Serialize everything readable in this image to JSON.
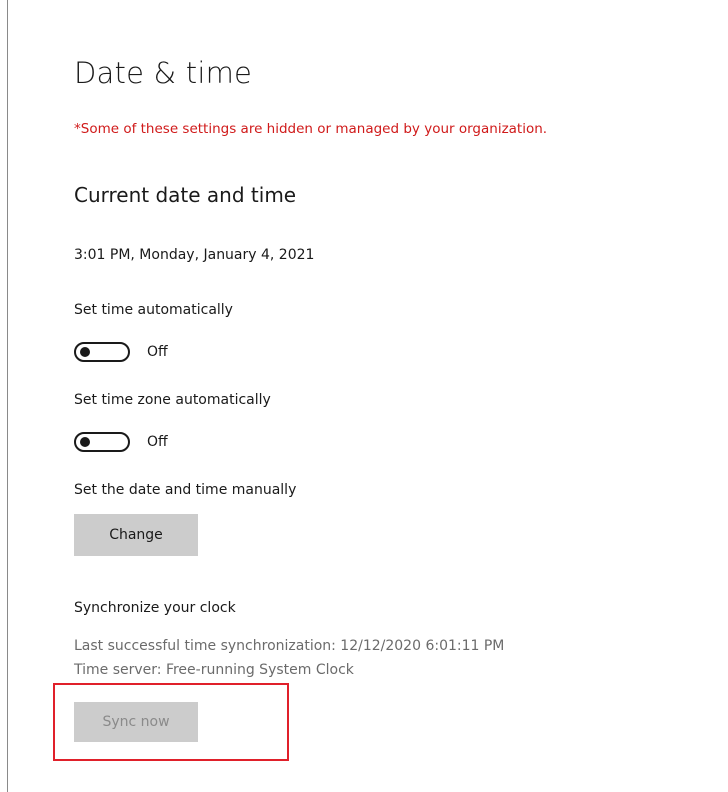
{
  "page": {
    "title": "Date & time",
    "org_notice": "*Some of these settings are hidden or managed by your organization."
  },
  "current": {
    "section_title": "Current date and time",
    "datetime": "3:01 PM, Monday, January 4, 2021"
  },
  "set_time_auto": {
    "label": "Set time automatically",
    "state_label": "Off",
    "on": false
  },
  "set_timezone_auto": {
    "label": "Set time zone automatically",
    "state_label": "Off",
    "on": false
  },
  "manual": {
    "label": "Set the date and time manually",
    "button_label": "Change"
  },
  "sync": {
    "label": "Synchronize your clock",
    "last_sync": "Last successful time synchronization: 12/12/2020 6:01:11 PM",
    "time_server": "Time server: Free-running System Clock",
    "button_label": "Sync now",
    "button_disabled": true
  },
  "colors": {
    "notice_red": "#d01a1a",
    "highlight_red": "#e0202a",
    "button_gray": "#cccccc"
  }
}
